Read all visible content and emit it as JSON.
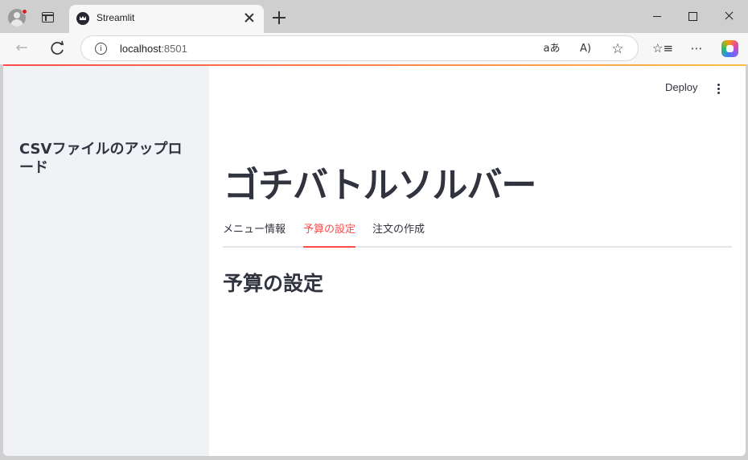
{
  "browser": {
    "tab_title": "Streamlit",
    "url_host": "localhost",
    "url_port": ":8501"
  },
  "app": {
    "deploy_label": "Deploy",
    "sidebar_title": "CSVファイルのアップロード",
    "title": "ゴチバトルソルバー",
    "tabs": [
      {
        "label": "メニュー情報"
      },
      {
        "label": "予算の設定"
      },
      {
        "label": "注文の作成"
      }
    ],
    "active_tab": "予算の設定",
    "section_title": "予算の設定",
    "accent_color": "#ff4b4b"
  }
}
